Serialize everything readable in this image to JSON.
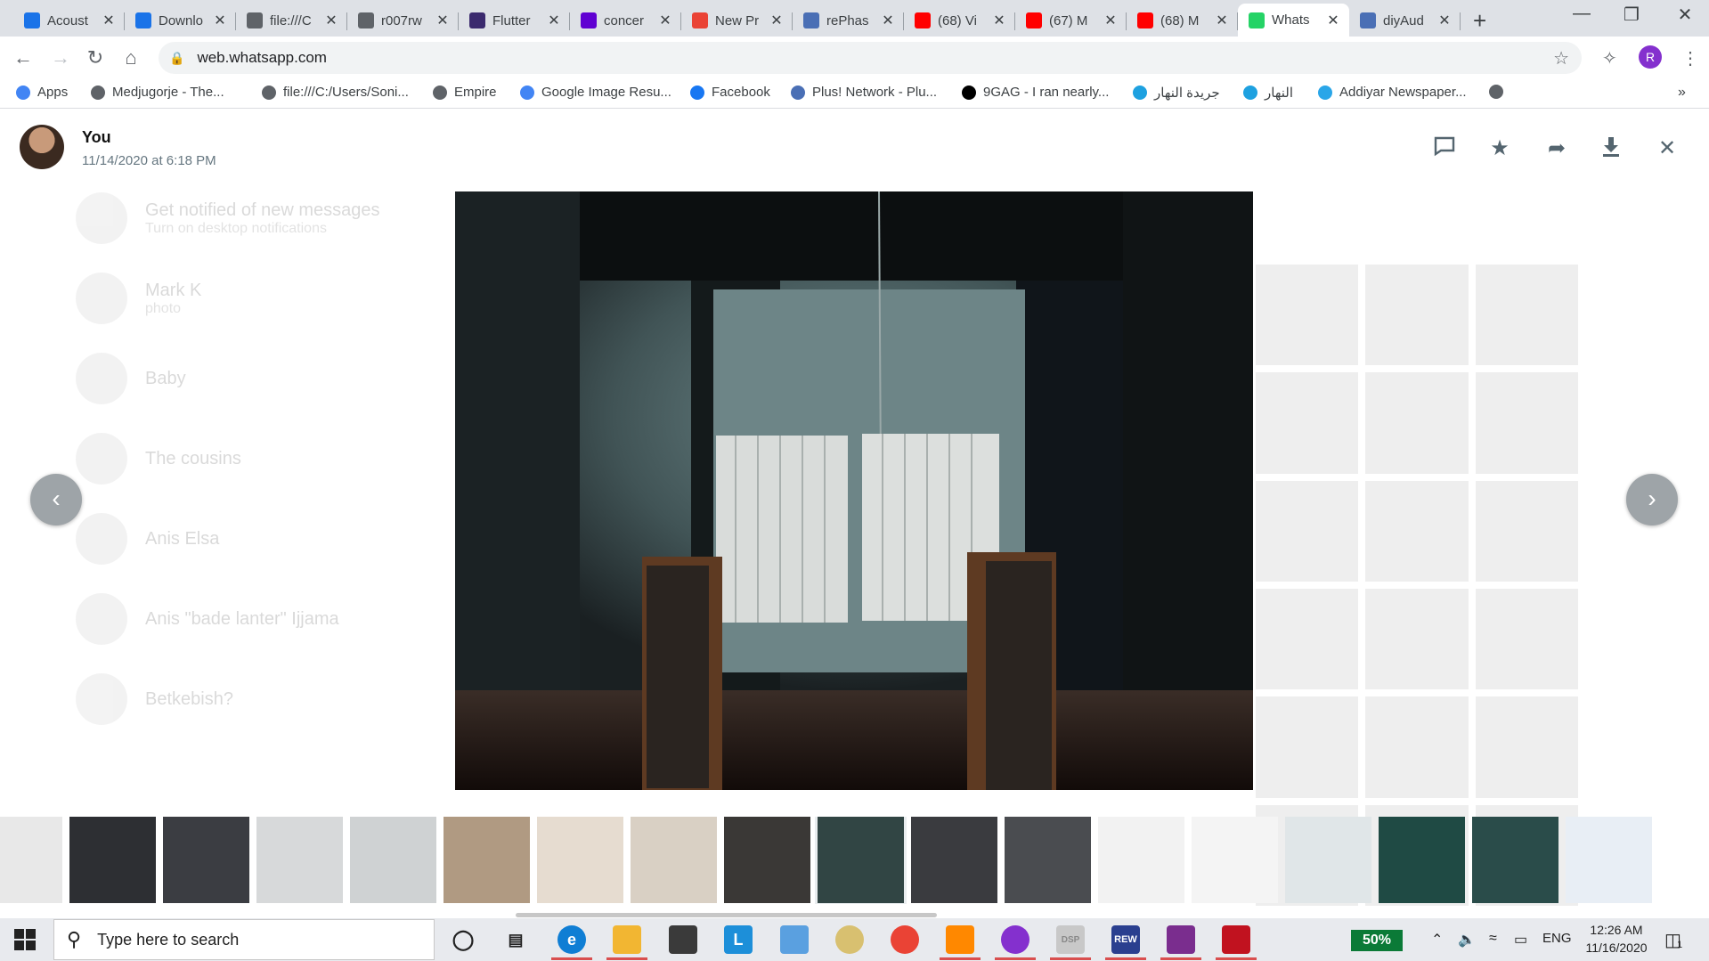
{
  "browser": {
    "tabs": [
      {
        "label": "Acoust",
        "icon": "google-drive-icon",
        "color": "#1a73e8"
      },
      {
        "label": "Downlo",
        "icon": "download-icon",
        "color": "#1a73e8"
      },
      {
        "label": "file:///C",
        "icon": "globe-icon",
        "color": "#5f6368"
      },
      {
        "label": "r007rw",
        "icon": "globe-icon",
        "color": "#5f6368"
      },
      {
        "label": "Flutter",
        "icon": "flutter-icon",
        "color": "#3b2a6e"
      },
      {
        "label": "concer",
        "icon": "yahoo-icon",
        "color": "#6001d2"
      },
      {
        "label": "New Pr",
        "icon": "gmail-icon",
        "color": "#ea4335"
      },
      {
        "label": "rePhas",
        "icon": "rephase-icon",
        "color": "#4a6fb5"
      },
      {
        "label": "(68) Vi",
        "icon": "youtube-icon",
        "color": "#ff0000"
      },
      {
        "label": "(67) M",
        "icon": "youtube-icon",
        "color": "#ff0000"
      },
      {
        "label": "(68) M",
        "icon": "youtube-icon",
        "color": "#ff0000"
      },
      {
        "label": "Whats",
        "icon": "whatsapp-icon",
        "color": "#25d366",
        "active": true
      },
      {
        "label": "diyAud",
        "icon": "diyaudio-icon",
        "color": "#4a6fb5"
      }
    ],
    "url": "web.whatsapp.com",
    "profile_initial": "R",
    "bookmarks": [
      {
        "label": "Apps",
        "icon": "apps-grid-icon",
        "color": "#4285f4"
      },
      {
        "label": "Medjugorje - The...",
        "icon": "globe-icon",
        "color": "#5f6368"
      },
      {
        "label": "file:///C:/Users/Soni...",
        "icon": "globe-icon",
        "color": "#5f6368"
      },
      {
        "label": "Empire",
        "icon": "globe-icon",
        "color": "#5f6368"
      },
      {
        "label": "Google Image Resu...",
        "icon": "google-icon",
        "color": "#4285f4"
      },
      {
        "label": "Facebook",
        "icon": "facebook-icon",
        "color": "#1877f2"
      },
      {
        "label": "Plus! Network - Plu...",
        "icon": "plus-network-icon",
        "color": "#4a6fb5"
      },
      {
        "label": "9GAG - I ran nearly...",
        "icon": "9gag-icon",
        "color": "#000000"
      },
      {
        "label": "جريدة النهار",
        "icon": "annahar-icon",
        "color": "#1ea1e0"
      },
      {
        "label": "النهار",
        "icon": "annahar-icon",
        "color": "#1ea1e0"
      },
      {
        "label": "Addiyar Newspaper...",
        "icon": "addiyar-icon",
        "color": "#2aa6e8"
      }
    ],
    "more_bookmarks": "»"
  },
  "viewer": {
    "sender": "You",
    "date": "11/14/2020 at 6:18 PM",
    "actions": [
      "reply-icon",
      "star-icon",
      "forward-icon",
      "download-icon",
      "close-icon"
    ],
    "background_chats": [
      {
        "name": "Get notified of new messages",
        "sub": "Turn on desktop notifications"
      },
      {
        "name": "Mark K",
        "sub": "photo"
      },
      {
        "name": "Baby",
        "sub": ""
      },
      {
        "name": "The cousins",
        "sub": ""
      },
      {
        "name": "Anis Elsa",
        "sub": ""
      },
      {
        "name": "Anis \"bade lanter\" Ijjama",
        "sub": ""
      },
      {
        "name": "Betkebish?",
        "sub": ""
      }
    ]
  },
  "thumbs": {
    "active_index": 9,
    "count": 18
  },
  "taskbar": {
    "search_placeholder": "Type here to search",
    "battery_badge": "50%",
    "language": "ENG",
    "time": "12:26 AM",
    "date": "11/16/2020",
    "notification_count": "1"
  }
}
